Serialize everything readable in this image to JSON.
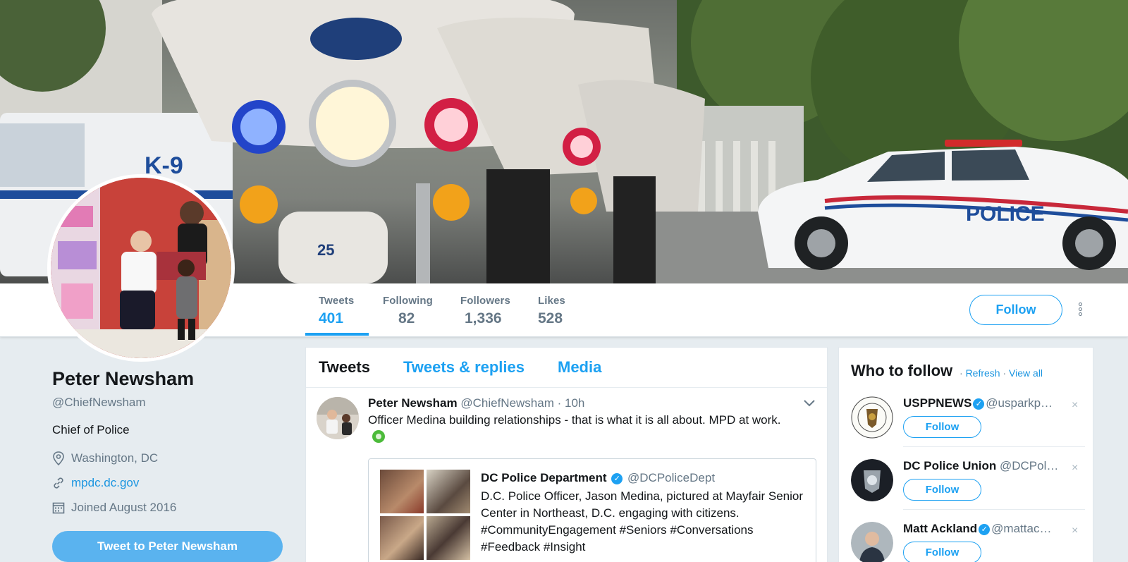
{
  "banner": {
    "k9_text": "K-9",
    "police_text": "POLICE",
    "bike_number": "25"
  },
  "stats": [
    {
      "label": "Tweets",
      "value": "401"
    },
    {
      "label": "Following",
      "value": "82"
    },
    {
      "label": "Followers",
      "value": "1,336"
    },
    {
      "label": "Likes",
      "value": "528"
    }
  ],
  "follow_label": "Follow",
  "profile": {
    "name": "Peter Newsham",
    "handle": "@ChiefNewsham",
    "bio": "Chief of Police",
    "location": "Washington, DC",
    "website": "mpdc.dc.gov",
    "joined": "Joined August 2016",
    "tweet_to": "Tweet to Peter Newsham"
  },
  "timeline": {
    "tabs": [
      "Tweets",
      "Tweets & replies",
      "Media"
    ],
    "tweet": {
      "name": "Peter Newsham",
      "handle": "@ChiefNewsham",
      "time": "· 10h",
      "text": "Officer Medina building relationships - that is what it is all about.  MPD at work.",
      "quote": {
        "name": "DC Police Department",
        "handle": "@DCPoliceDept",
        "text": "D.C. Police Officer, Jason Medina, pictured at Mayfair Senior Center in Northeast, D.C. engaging with citizens. #CommunityEngagement #Seniors #Conversations #Feedback #Insight"
      }
    }
  },
  "who_to_follow": {
    "title": "Who to follow",
    "sep": "·",
    "refresh": "Refresh",
    "view_all": "View all",
    "items": [
      {
        "name": "USPPNEWS",
        "handle": "@usparkp…",
        "verified": true,
        "follow": "Follow",
        "close": "×"
      },
      {
        "name": "DC Police Union",
        "handle": "@DCPol…",
        "verified": false,
        "follow": "Follow",
        "close": "×"
      },
      {
        "name": "Matt Ackland",
        "handle": "@mattac…",
        "verified": true,
        "follow": "Follow",
        "close": "×"
      }
    ]
  },
  "colors": {
    "accent": "#1da1f2",
    "link": "#1b95e0",
    "muted": "#657786",
    "background": "#e6ecf0"
  }
}
